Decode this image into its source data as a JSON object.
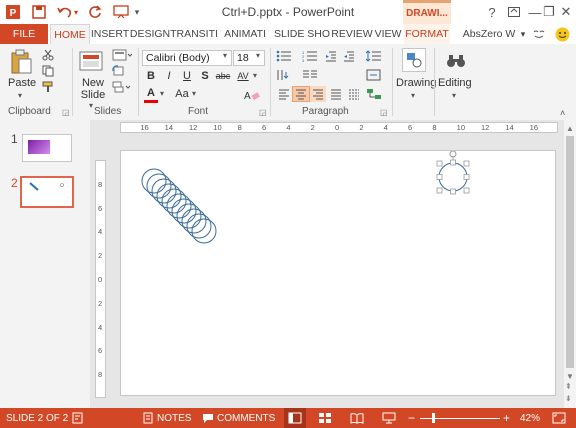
{
  "window": {
    "title": "Ctrl+D.pptx - PowerPoint",
    "contextual_tab": "DRAWI...",
    "help": "?",
    "min": "—",
    "restore": "❐",
    "close": "✕"
  },
  "tabs": [
    "FILE",
    "HOME",
    "INSERT",
    "DESIGN",
    "TRANSITI",
    "ANIMATI",
    "SLIDE SHO",
    "REVIEW",
    "VIEW",
    "FORMAT"
  ],
  "account": {
    "name": "AbsZero W",
    "caret": "▾"
  },
  "ribbon": {
    "paste_label": "Paste",
    "new_slide_label": "New\nSlide",
    "new_slide_line1": "New",
    "new_slide_line2": "Slide",
    "font_name": "Calibri (Body)",
    "font_size": "18",
    "bold": "B",
    "italic": "I",
    "underline": "U",
    "shadow": "S",
    "strike": "abc",
    "spacing": "AV",
    "font_color": "A",
    "change_case": "Aa",
    "grow": "A",
    "shrink": "A",
    "clear": "A",
    "drawing_label": "Drawing",
    "editing_label": "Editing",
    "groups": {
      "clipboard": "Clipboard",
      "slides": "Slides",
      "font": "Font",
      "paragraph": "Paragraph"
    }
  },
  "thumbnails": [
    {
      "number": "1"
    },
    {
      "number": "2"
    }
  ],
  "ruler": {
    "h_ticks": [
      "16",
      "14",
      "12",
      "10",
      "8",
      "6",
      "4",
      "2",
      "0",
      "2",
      "4",
      "6",
      "8",
      "10",
      "12",
      "14",
      "16"
    ],
    "v_ticks": [
      "8",
      "6",
      "4",
      "2",
      "0",
      "2",
      "4",
      "6",
      "8"
    ]
  },
  "status": {
    "slide": "SLIDE 2 OF 2",
    "notes": "NOTES",
    "comments": "COMMENTS",
    "zoom": "42%",
    "minus": "−",
    "plus": "+"
  },
  "colors": {
    "accent": "#d24726",
    "thumb1_gradient": "#b23cd6"
  }
}
